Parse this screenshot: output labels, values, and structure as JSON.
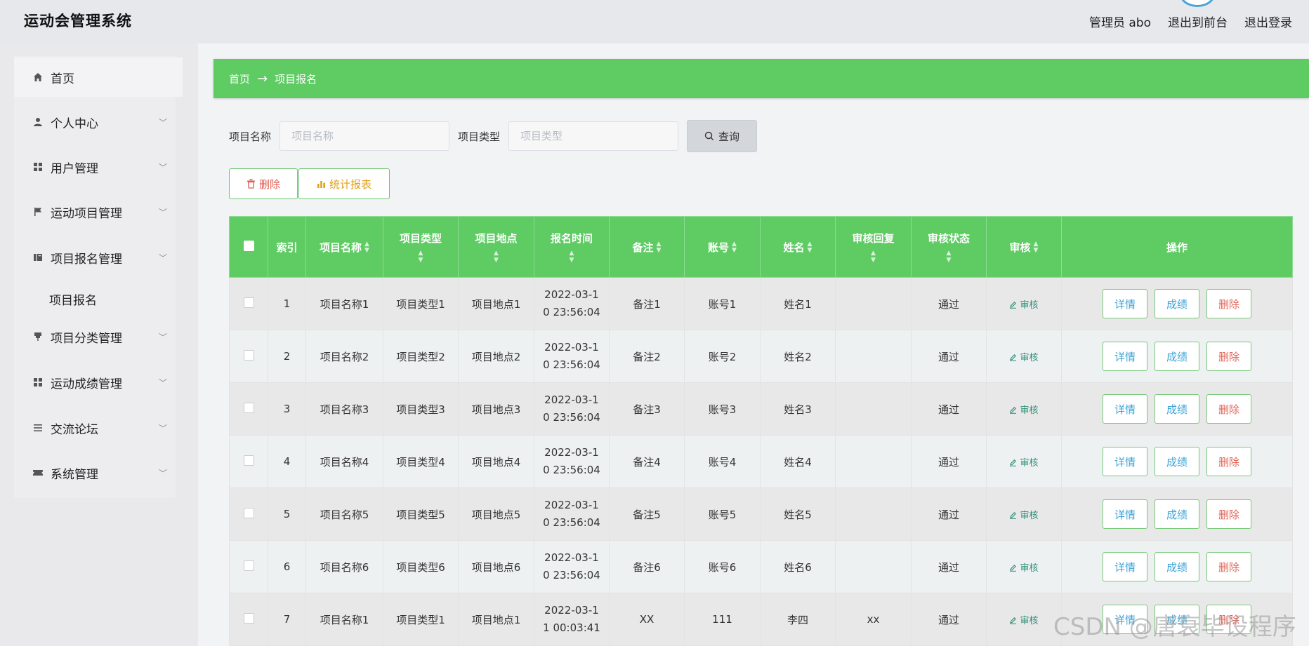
{
  "header": {
    "app_title": "运动会管理系统",
    "admin_label": "管理员 abo",
    "goto_front": "退出到前台",
    "logout": "退出登录"
  },
  "sidebar": {
    "items": [
      {
        "label": "首页",
        "icon": "home-icon"
      },
      {
        "label": "个人中心",
        "icon": "user-icon"
      },
      {
        "label": "用户管理",
        "icon": "grid-icon"
      },
      {
        "label": "运动项目管理",
        "icon": "flag-icon"
      },
      {
        "label": "项目报名管理",
        "icon": "book-icon"
      },
      {
        "label": "项目报名",
        "icon": ""
      },
      {
        "label": "项目分类管理",
        "icon": "pin-icon"
      },
      {
        "label": "运动成绩管理",
        "icon": "grid-icon"
      },
      {
        "label": "交流论坛",
        "icon": "list-icon"
      },
      {
        "label": "系统管理",
        "icon": "ticket-icon"
      }
    ]
  },
  "breadcrumb": {
    "home": "首页",
    "arrow": "→",
    "current": "项目报名"
  },
  "search": {
    "name_label": "项目名称",
    "name_placeholder": "项目名称",
    "type_label": "项目类型",
    "type_placeholder": "项目类型",
    "query_button": "查询"
  },
  "actions": {
    "delete": "删除",
    "report": "统计报表"
  },
  "table": {
    "columns": [
      "索引",
      "项目名称",
      "项目类型",
      "项目地点",
      "报名时间",
      "备注",
      "账号",
      "姓名",
      "审核回复",
      "审核状态",
      "审核",
      "操作"
    ],
    "rows": [
      {
        "index": "1",
        "name": "项目名称1",
        "type": "项目类型1",
        "place": "项目地点1",
        "time1": "2022-03-1",
        "time2": "0 23:56:04",
        "note": "备注1",
        "account": "账号1",
        "person": "姓名1",
        "reply": "",
        "status": "通过",
        "audit": "审核"
      },
      {
        "index": "2",
        "name": "项目名称2",
        "type": "项目类型2",
        "place": "项目地点2",
        "time1": "2022-03-1",
        "time2": "0 23:56:04",
        "note": "备注2",
        "account": "账号2",
        "person": "姓名2",
        "reply": "",
        "status": "通过",
        "audit": "审核"
      },
      {
        "index": "3",
        "name": "项目名称3",
        "type": "项目类型3",
        "place": "项目地点3",
        "time1": "2022-03-1",
        "time2": "0 23:56:04",
        "note": "备注3",
        "account": "账号3",
        "person": "姓名3",
        "reply": "",
        "status": "通过",
        "audit": "审核"
      },
      {
        "index": "4",
        "name": "项目名称4",
        "type": "项目类型4",
        "place": "项目地点4",
        "time1": "2022-03-1",
        "time2": "0 23:56:04",
        "note": "备注4",
        "account": "账号4",
        "person": "姓名4",
        "reply": "",
        "status": "通过",
        "audit": "审核"
      },
      {
        "index": "5",
        "name": "项目名称5",
        "type": "项目类型5",
        "place": "项目地点5",
        "time1": "2022-03-1",
        "time2": "0 23:56:04",
        "note": "备注5",
        "account": "账号5",
        "person": "姓名5",
        "reply": "",
        "status": "通过",
        "audit": "审核"
      },
      {
        "index": "6",
        "name": "项目名称6",
        "type": "项目类型6",
        "place": "项目地点6",
        "time1": "2022-03-1",
        "time2": "0 23:56:04",
        "note": "备注6",
        "account": "账号6",
        "person": "姓名6",
        "reply": "",
        "status": "通过",
        "audit": "审核"
      },
      {
        "index": "7",
        "name": "项目名称1",
        "type": "项目类型1",
        "place": "项目地点1",
        "time1": "2022-03-1",
        "time2": "1 00:03:41",
        "note": "XX",
        "account": "111",
        "person": "李四",
        "reply": "xx",
        "status": "通过",
        "audit": "审核"
      }
    ],
    "row_buttons": {
      "detail": "详情",
      "score": "成绩",
      "remove": "删除"
    }
  },
  "watermark": "CSDN @唐衰毕设程序",
  "colors": {
    "accent_green": "#5ecb63",
    "delete_red": "#e05a4e",
    "report_orange": "#e0a11a",
    "link_blue": "#3ea3d6"
  }
}
